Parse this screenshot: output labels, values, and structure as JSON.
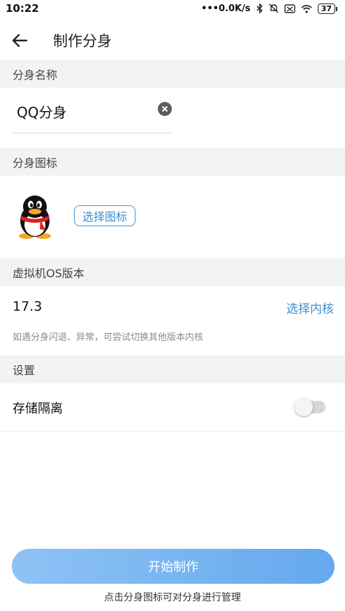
{
  "status_bar": {
    "time": "10:22",
    "network_speed": "•••0.0K/s",
    "battery": "37",
    "icons": [
      "bluetooth-icon",
      "mute-icon",
      "sim-icon",
      "wifi-icon",
      "battery-icon"
    ]
  },
  "header": {
    "title": "制作分身",
    "back_icon": "arrow-left-icon"
  },
  "sections": {
    "name": {
      "header": "分身名称",
      "input_value": "QQ分身"
    },
    "icon": {
      "header": "分身图标",
      "choose_button": "选择图标",
      "app_icon": "qq-penguin-icon"
    },
    "os": {
      "header": "虚拟机OS版本",
      "version": "17.3",
      "choose_kernel": "选择内核",
      "hint": "如遇分身闪退、异常，可尝试切换其他版本内核"
    },
    "settings": {
      "header": "设置",
      "storage_isolation_label": "存储隔离",
      "storage_isolation_enabled": false
    }
  },
  "footer": {
    "start_button": "开始制作",
    "hint": "点击分身图标可对分身进行管理"
  },
  "colors": {
    "accent": "#3b8ed0",
    "section_bg": "#f3f3f3",
    "button_gradient_start": "#8ec3f5",
    "button_gradient_end": "#64a8ee"
  }
}
